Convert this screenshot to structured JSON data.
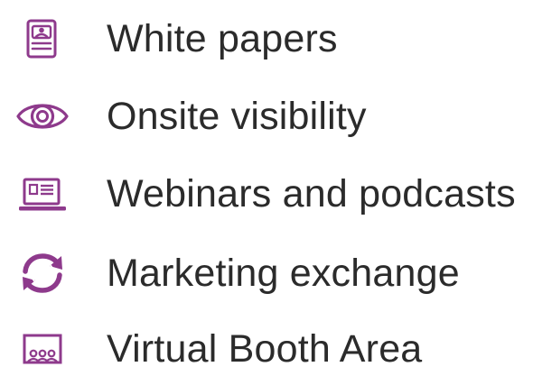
{
  "colors": {
    "icon": "#8e3a8c",
    "text": "#2b2b2b",
    "background": "#ffffff"
  },
  "features": [
    {
      "icon": "document-person-icon",
      "label": "White papers"
    },
    {
      "icon": "eye-icon",
      "label": "Onsite visibility"
    },
    {
      "icon": "laptop-icon",
      "label": "Webinars and podcasts"
    },
    {
      "icon": "exchange-arrows-icon",
      "label": "Marketing exchange"
    },
    {
      "icon": "booth-icon",
      "label": "Virtual Booth Area"
    }
  ]
}
